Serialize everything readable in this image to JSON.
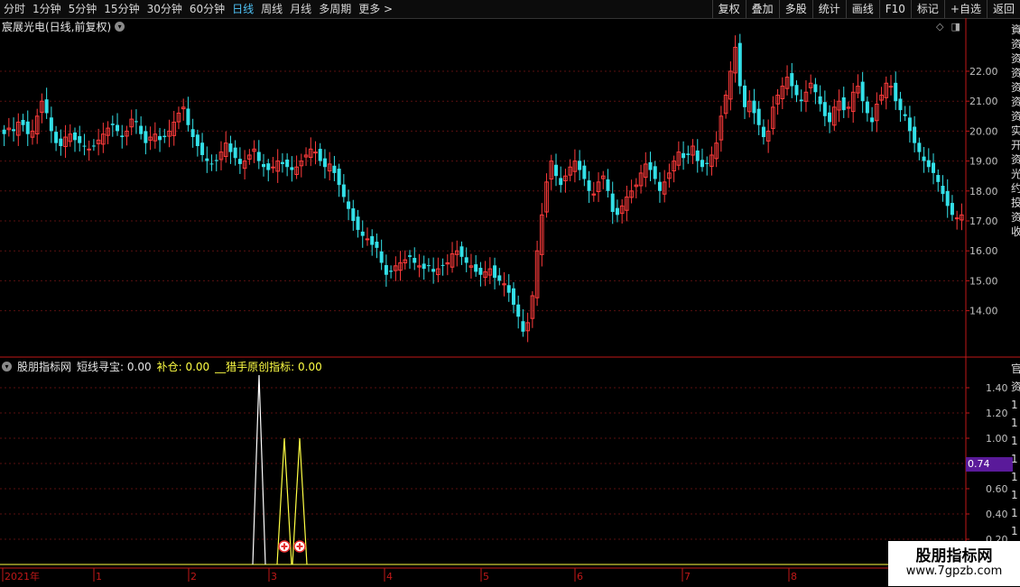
{
  "toolbar": {
    "periods": [
      "分时",
      "1分钟",
      "5分钟",
      "15分钟",
      "30分钟",
      "60分钟",
      "日线",
      "周线",
      "月线",
      "多周期",
      "更多 >"
    ],
    "active_period": "日线",
    "tools": [
      "复权",
      "叠加",
      "多股",
      "统计",
      "画线",
      "F10",
      "标记",
      "+自选",
      "返回"
    ]
  },
  "main_panel": {
    "title": "宸展光电(日线,前复权)",
    "y_ticks": [
      "22.00",
      "21.00",
      "20.00",
      "19.00",
      "18.00",
      "17.00",
      "16.00",
      "15.00",
      "14.00"
    ]
  },
  "indicator_panel": {
    "name": "股朋指标网",
    "line1": "短线寻宝: 0.00",
    "line2": "补仓: 0.00",
    "line3": "__猎手原创指标: 0.00",
    "y_ticks": [
      "1.40",
      "1.20",
      "1.00",
      "0.80",
      "0.60",
      "0.40",
      "0.20"
    ],
    "current_value": "0.74"
  },
  "x_axis": {
    "labels": [
      "2021年",
      "1",
      "2",
      "3",
      "4",
      "5",
      "6",
      "7",
      "8"
    ]
  },
  "right_strip_chars": [
    "資",
    "资",
    "资",
    "资",
    "资",
    "资",
    "资",
    "实",
    "开",
    "资",
    "光",
    "约",
    "投",
    "资",
    "收"
  ],
  "right_strip_lower": [
    "官",
    "资",
    "1",
    "1",
    "1",
    "1",
    "1",
    "1",
    "1",
    "1",
    "1",
    "1"
  ],
  "watermark": {
    "title": "股朋指标网",
    "url": "www.7gpzb.com"
  },
  "colors": {
    "up": "#ff3b3b",
    "down": "#33e0e8",
    "grid": "#5a1010",
    "axis": "#c01818",
    "indicator_white": "#ffffff",
    "indicator_yellow": "#ffff44"
  },
  "chart_data": {
    "type": "candlestick",
    "ylim": [
      13.0,
      23.0
    ],
    "closes": [
      19.9,
      20.1,
      20.0,
      20.3,
      20.2,
      19.9,
      20.0,
      20.5,
      21.0,
      20.6,
      20.0,
      19.6,
      19.5,
      19.8,
      19.9,
      19.7,
      19.6,
      19.5,
      19.4,
      19.5,
      19.7,
      19.9,
      20.1,
      20.2,
      20.0,
      19.8,
      20.0,
      20.4,
      20.3,
      19.9,
      19.6,
      19.8,
      19.9,
      19.7,
      19.8,
      20.0,
      20.3,
      20.6,
      20.8,
      20.2,
      19.8,
      19.5,
      19.2,
      19.0,
      18.9,
      19.0,
      19.3,
      19.6,
      19.3,
      19.1,
      18.9,
      19.0,
      19.2,
      19.4,
      19.0,
      18.8,
      18.7,
      18.8,
      19.0,
      18.9,
      18.8,
      18.7,
      18.8,
      19.0,
      19.2,
      19.4,
      19.3,
      19.0,
      18.8,
      18.9,
      18.6,
      18.2,
      17.8,
      17.4,
      17.0,
      16.7,
      16.5,
      16.4,
      16.2,
      16.1,
      15.6,
      15.2,
      15.3,
      15.5,
      15.6,
      15.7,
      15.8,
      15.6,
      15.5,
      15.4,
      15.5,
      15.3,
      15.4,
      15.5,
      15.6,
      15.9,
      16.0,
      15.8,
      15.6,
      15.5,
      15.3,
      15.2,
      15.3,
      15.4,
      15.1,
      15.0,
      14.9,
      14.6,
      14.2,
      13.8,
      13.3,
      13.6,
      14.5,
      16.0,
      17.2,
      18.3,
      19.0,
      18.5,
      18.2,
      18.5,
      18.8,
      19.0,
      18.7,
      18.4,
      18.0,
      17.9,
      18.3,
      18.5,
      18.0,
      17.3,
      17.2,
      17.5,
      17.8,
      18.0,
      18.2,
      18.6,
      18.9,
      18.7,
      18.4,
      18.0,
      18.3,
      18.6,
      19.0,
      19.3,
      19.1,
      19.2,
      19.5,
      19.0,
      18.8,
      18.9,
      19.2,
      19.6,
      20.5,
      21.2,
      22.0,
      22.8,
      21.5,
      20.8,
      21.0,
      20.6,
      20.2,
      19.8,
      20.0,
      20.8,
      21.2,
      21.5,
      21.8,
      21.5,
      21.2,
      21.0,
      21.3,
      21.6,
      21.3,
      20.9,
      20.5,
      20.3,
      20.8,
      21.0,
      20.7,
      20.8,
      21.3,
      21.5,
      21.0,
      20.6,
      20.3,
      20.9,
      21.2,
      21.6,
      21.5,
      21.0,
      20.7,
      20.5,
      20.0,
      19.6,
      19.3,
      19.0,
      18.8,
      18.6,
      18.3,
      17.9,
      17.5,
      17.2,
      17.1,
      17.2
    ],
    "indicator": {
      "white_peak": 1.5,
      "yellow_peaks": [
        1.0,
        1.0
      ]
    }
  }
}
